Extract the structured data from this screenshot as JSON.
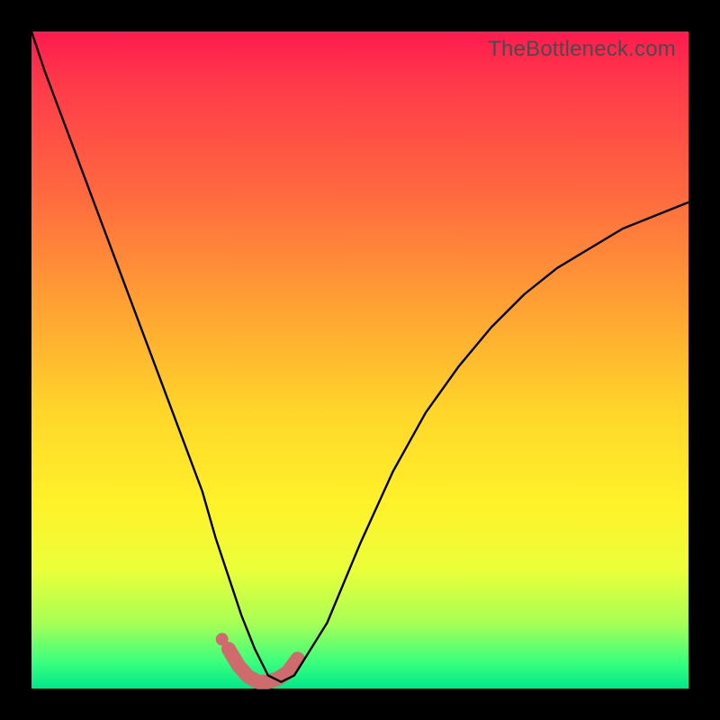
{
  "watermark": "TheBottleneck.com",
  "chart_data": {
    "type": "line",
    "title": "",
    "xlabel": "",
    "ylabel": "",
    "xlim": [
      0,
      1
    ],
    "ylim": [
      0,
      1
    ],
    "series": [
      {
        "name": "curve",
        "x": [
          0.0,
          0.02,
          0.05,
          0.08,
          0.11,
          0.14,
          0.17,
          0.2,
          0.23,
          0.26,
          0.28,
          0.3,
          0.32,
          0.34,
          0.36,
          0.38,
          0.4,
          0.45,
          0.5,
          0.55,
          0.6,
          0.65,
          0.7,
          0.75,
          0.8,
          0.85,
          0.9,
          0.95,
          1.0
        ],
        "values": [
          1.0,
          0.94,
          0.86,
          0.78,
          0.7,
          0.62,
          0.54,
          0.46,
          0.38,
          0.3,
          0.23,
          0.17,
          0.11,
          0.06,
          0.02,
          0.01,
          0.02,
          0.1,
          0.22,
          0.33,
          0.42,
          0.49,
          0.55,
          0.6,
          0.64,
          0.67,
          0.7,
          0.72,
          0.74
        ]
      }
    ],
    "highlight": {
      "name": "trough",
      "x": [
        0.3,
        0.315,
        0.33,
        0.345,
        0.36,
        0.375,
        0.39,
        0.405
      ],
      "values": [
        0.06,
        0.035,
        0.018,
        0.01,
        0.01,
        0.015,
        0.025,
        0.045
      ]
    },
    "highlight_dot": {
      "x": 0.29,
      "value": 0.075
    },
    "background_gradient_stops": [
      {
        "pos": 0.0,
        "color": "#ff1a4f"
      },
      {
        "pos": 0.25,
        "color": "#ff6a3f"
      },
      {
        "pos": 0.58,
        "color": "#ffd62a"
      },
      {
        "pos": 0.82,
        "color": "#eaff3a"
      },
      {
        "pos": 1.0,
        "color": "#00e88a"
      }
    ]
  }
}
